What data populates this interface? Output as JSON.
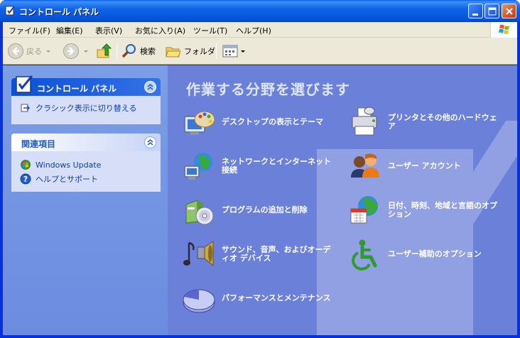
{
  "window": {
    "title": "コントロール パネル"
  },
  "menu": [
    "ファイル(F)",
    "編集(E)",
    "表示(V)",
    "お気に入り(A)",
    "ツール(T)",
    "ヘルプ(H)"
  ],
  "toolbar": {
    "back_label": "戻る",
    "search_label": "検索",
    "folders_label": "フォルダ"
  },
  "sidebar": {
    "control_panel": {
      "title": "コントロール パネル",
      "switch_view_label": "クラシック表示に切り替える"
    },
    "related": {
      "title": "関連項目",
      "items": [
        {
          "label": "Windows Update"
        },
        {
          "label": "ヘルプとサポート"
        }
      ]
    }
  },
  "main": {
    "heading": "作業する分野を選びます",
    "categories": [
      {
        "label": "デスクトップの表示とテーマ",
        "icon": "desktop-theme-icon"
      },
      {
        "label": "プリンタとその他のハードウェア",
        "icon": "printer-icon"
      },
      {
        "label": "ネットワークとインターネット接続",
        "icon": "network-icon"
      },
      {
        "label": "ユーザー アカウント",
        "icon": "user-accounts-icon"
      },
      {
        "label": "プログラムの追加と削除",
        "icon": "add-remove-programs-icon"
      },
      {
        "label": "日付、時刻、地域と言語のオプション",
        "icon": "date-time-icon"
      },
      {
        "label": "サウンド、音声、およびオーディオ デバイス",
        "icon": "sound-icon"
      },
      {
        "label": "ユーザー補助のオプション",
        "icon": "accessibility-icon"
      },
      {
        "label": "パフォーマンスとメンテナンス",
        "icon": "performance-icon"
      }
    ]
  },
  "colors": {
    "titlebar": "#0452dc",
    "main_bg": "#6b81d9",
    "link": "#0c3faa"
  }
}
